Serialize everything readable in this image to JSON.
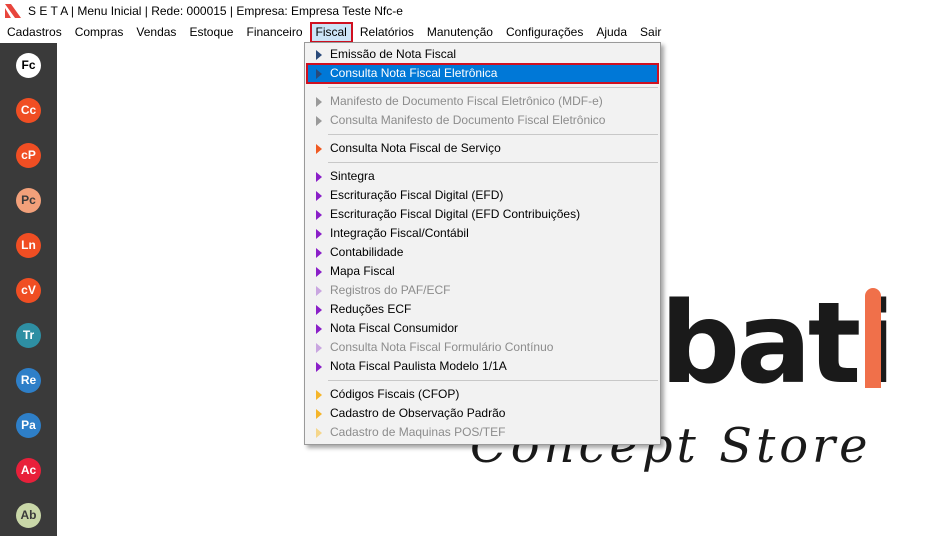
{
  "window": {
    "title": "S E T A | Menu Inicial | Rede: 000015 | Empresa: Empresa Teste Nfc-e"
  },
  "menubar": {
    "items": [
      {
        "label": "Cadastros"
      },
      {
        "label": "Compras"
      },
      {
        "label": "Vendas"
      },
      {
        "label": "Estoque"
      },
      {
        "label": "Financeiro"
      },
      {
        "label": "Fiscal",
        "active": true
      },
      {
        "label": "Relatórios"
      },
      {
        "label": "Manutenção"
      },
      {
        "label": "Configurações"
      },
      {
        "label": "Ajuda"
      },
      {
        "label": "Sair"
      }
    ]
  },
  "sidebar": {
    "buttons": [
      {
        "label": "Fc",
        "color": "#ffffff",
        "text_color": "#000000"
      },
      {
        "label": "Cc",
        "color": "#f04e23"
      },
      {
        "label": "cP",
        "color": "#f04e23"
      },
      {
        "label": "Pc",
        "color": "#f2a07a",
        "text_color": "#3a3a3a"
      },
      {
        "label": "Ln",
        "color": "#f04e23"
      },
      {
        "label": "cV",
        "color": "#f04e23"
      },
      {
        "label": "Tr",
        "color": "#2e8fa3"
      },
      {
        "label": "Re",
        "color": "#2e7fc8"
      },
      {
        "label": "Pa",
        "color": "#2e7fc8"
      },
      {
        "label": "Ac",
        "color": "#e8203a"
      },
      {
        "label": "Ab",
        "color": "#c9d7a8",
        "text_color": "#3a3a3a"
      }
    ]
  },
  "dropdown": {
    "groups": [
      [
        {
          "label": "Emissão de Nota Fiscal",
          "icon_color": "#2a4a7a",
          "disabled": false
        },
        {
          "label": "Consulta Nota Fiscal Eletrônica",
          "icon_color": "#2a4a7a",
          "disabled": false,
          "highlighted": true
        }
      ],
      [
        {
          "label": "Manifesto de Documento Fiscal Eletrônico (MDF-e)",
          "icon_color": "#9a9a9a",
          "disabled": true
        },
        {
          "label": "Consulta Manifesto de Documento Fiscal Eletrônico",
          "icon_color": "#9a9a9a",
          "disabled": true
        }
      ],
      [
        {
          "label": "Consulta Nota Fiscal de Serviço",
          "icon_color": "#f05a22",
          "disabled": false
        }
      ],
      [
        {
          "label": "Sintegra",
          "icon_color": "#8a1fc8",
          "disabled": false
        },
        {
          "label": "Escrituração Fiscal Digital (EFD)",
          "icon_color": "#8a1fc8",
          "disabled": false
        },
        {
          "label": "Escrituração Fiscal Digital (EFD Contribuições)",
          "icon_color": "#8a1fc8",
          "disabled": false
        },
        {
          "label": "Integração Fiscal/Contábil",
          "icon_color": "#8a1fc8",
          "disabled": false
        },
        {
          "label": "Contabilidade",
          "icon_color": "#8a1fc8",
          "disabled": false
        },
        {
          "label": "Mapa Fiscal",
          "icon_color": "#8a1fc8",
          "disabled": false
        },
        {
          "label": "Registros do PAF/ECF",
          "icon_color": "#c9a6e0",
          "disabled": true
        },
        {
          "label": "Reduções ECF",
          "icon_color": "#8a1fc8",
          "disabled": false
        },
        {
          "label": "Nota Fiscal Consumidor",
          "icon_color": "#8a1fc8",
          "disabled": false
        },
        {
          "label": "Consulta Nota Fiscal Formulário Contínuo",
          "icon_color": "#c9a6e0",
          "disabled": true
        },
        {
          "label": "Nota Fiscal Paulista Modelo 1/1A",
          "icon_color": "#8a1fc8",
          "disabled": false
        }
      ],
      [
        {
          "label": "Códigos Fiscais (CFOP)",
          "icon_color": "#f5b52a",
          "disabled": false
        },
        {
          "label": "Cadastro de Observação Padrão",
          "icon_color": "#f5b52a",
          "disabled": false
        },
        {
          "label": "Cadastro de Maquinas POS/TEF",
          "icon_color": "#f5d68a",
          "disabled": true
        }
      ]
    ]
  },
  "background_logo": {
    "word": "bati",
    "script": "Concept Store",
    "accent_color": "#f0704a"
  }
}
